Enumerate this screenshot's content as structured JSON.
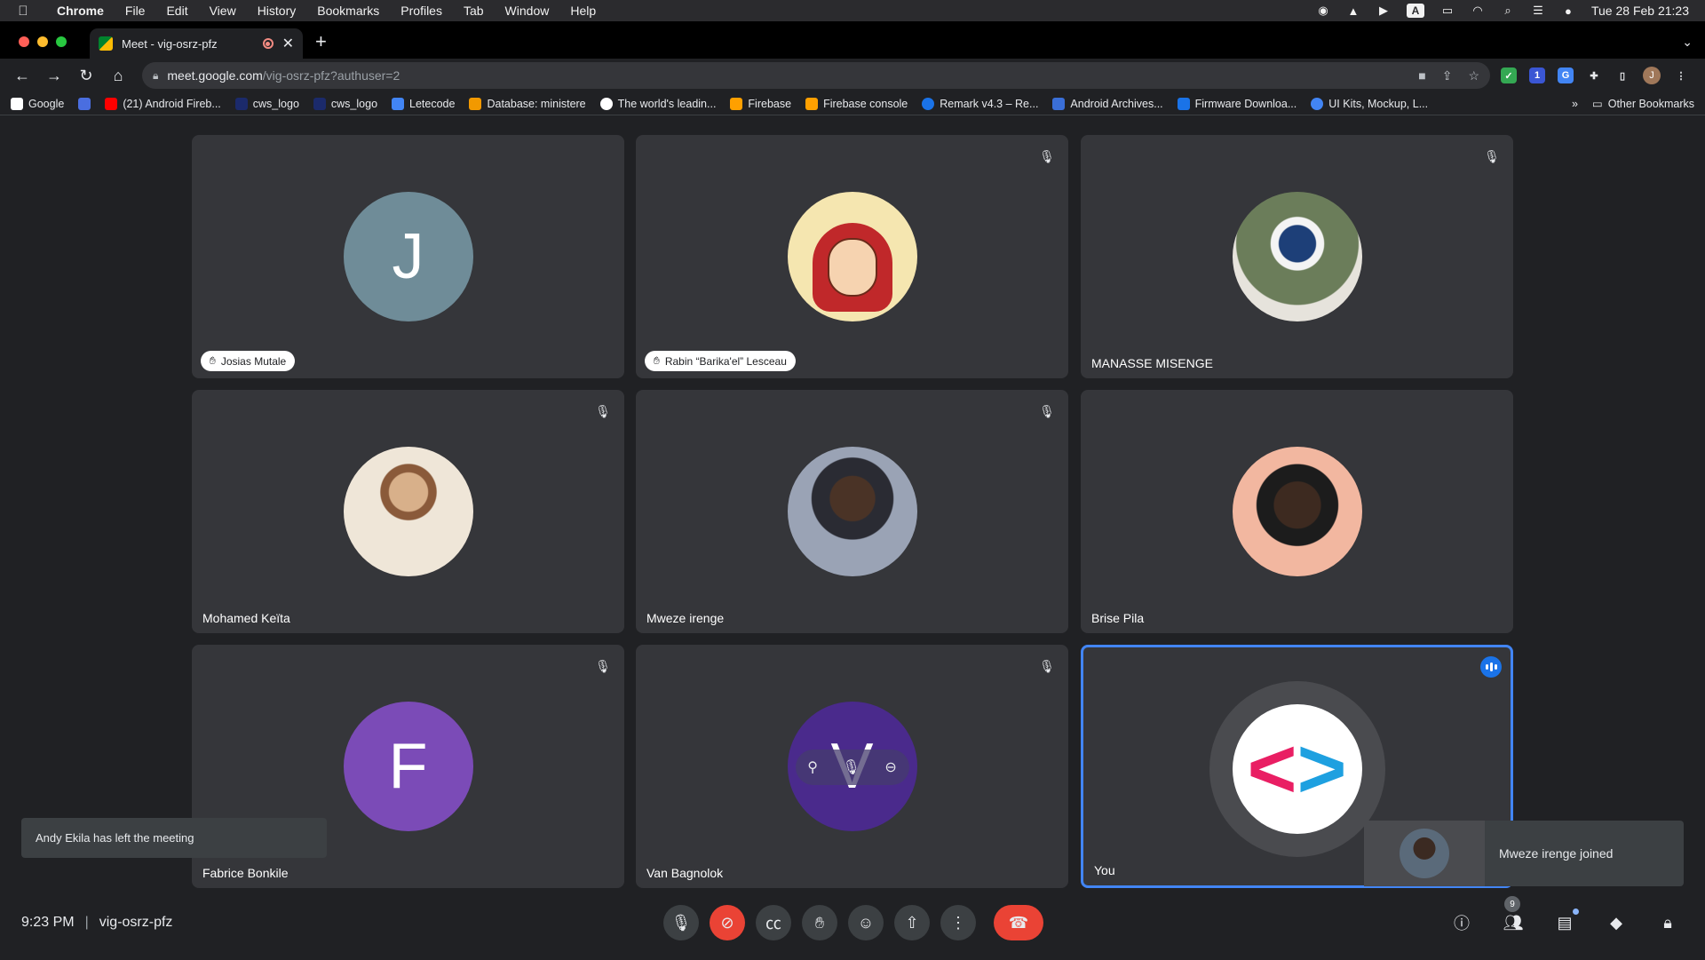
{
  "menubar": {
    "app_name": "Chrome",
    "items": [
      "File",
      "Edit",
      "View",
      "History",
      "Bookmarks",
      "Profiles",
      "Tab",
      "Window",
      "Help"
    ],
    "clock": "Tue 28 Feb  21:23",
    "input_source": "A"
  },
  "tab": {
    "title": "Meet - vig-osrz-pfz",
    "close": "✕"
  },
  "address": {
    "host": "meet.google.com",
    "path": "/vig-osrz-pfz?authuser=2",
    "profile_initial": "J"
  },
  "bookmarks": [
    {
      "label": "Google",
      "color": "#4285f4"
    },
    {
      "label": "",
      "color": "#4a6ee0"
    },
    {
      "label": "(21) Android Fireb...",
      "color": "#ff0000"
    },
    {
      "label": "cws_logo",
      "color": "#1b2a6b"
    },
    {
      "label": "cws_logo",
      "color": "#1b2a6b"
    },
    {
      "label": "Letecode",
      "color": "#4285f4"
    },
    {
      "label": "Database: ministere",
      "color": "#f29900"
    },
    {
      "label": "The world's leadin...",
      "color": "#ffffff"
    },
    {
      "label": "Firebase",
      "color": "#ffa000"
    },
    {
      "label": "Firebase console",
      "color": "#ffa000"
    },
    {
      "label": "Remark v4.3 – Re...",
      "color": "#1a73e8"
    },
    {
      "label": "Android Archives...",
      "color": "#3a6fd8"
    },
    {
      "label": "Firmware Downloa...",
      "color": "#1a73e8"
    },
    {
      "label": "UI Kits, Mockup, L...",
      "color": "#4285f4"
    }
  ],
  "bookmarks_more": "»",
  "bookmarks_other": "Other Bookmarks",
  "participants": [
    {
      "name": "Josias Mutale",
      "initial": "J",
      "style": "chip"
    },
    {
      "name": "Rabin “Barika'el” Lesceau",
      "initial": "",
      "style": "chip"
    },
    {
      "name": "MANASSE MISENGE",
      "initial": "",
      "style": "plain"
    },
    {
      "name": "Mohamed Keïta",
      "initial": "",
      "style": "plain"
    },
    {
      "name": "Mweze irenge",
      "initial": "",
      "style": "plain"
    },
    {
      "name": "Brise Pila",
      "initial": "",
      "style": "plain"
    },
    {
      "name": "Fabrice Bonkile",
      "initial": "F",
      "style": "plain"
    },
    {
      "name": "Van Bagnolok",
      "initial": "V",
      "style": "plain"
    },
    {
      "name": "You",
      "initial": "",
      "style": "plain"
    }
  ],
  "toasts": {
    "left": "Andy Ekila has left the meeting",
    "right": "Mweze irenge joined"
  },
  "bottom": {
    "time": "9:23 PM",
    "separator": "|",
    "meeting_code": "vig-osrz-pfz",
    "people_count": "9"
  },
  "colors": {
    "avatar_j": "#6f8c98",
    "avatar_f": "#7b4bb7",
    "avatar_v": "#4a2a8c",
    "active_border": "#4285f4",
    "danger": "#ea4335"
  }
}
